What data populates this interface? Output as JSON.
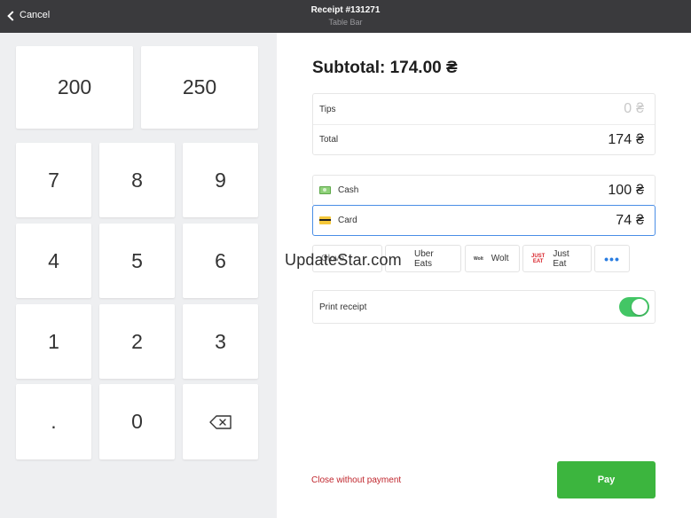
{
  "header": {
    "cancel_label": "Cancel",
    "title": "Receipt #131271",
    "subtitle": "Table Bar"
  },
  "keypad": {
    "quick": [
      "200",
      "250"
    ],
    "keys": [
      "7",
      "8",
      "9",
      "4",
      "5",
      "6",
      "1",
      "2",
      "3",
      ".",
      "0"
    ],
    "backspace_icon": "backspace-icon"
  },
  "summary": {
    "subtotal_label": "Subtotal: 174.00 ₴",
    "tips_label": "Tips",
    "tips_value": "0",
    "total_label": "Total",
    "total_value": "174",
    "currency": "₴"
  },
  "payments": {
    "cash_label": "Cash",
    "cash_value": "100",
    "card_label": "Card",
    "card_value": "74"
  },
  "methods": {
    "first": "Glovo",
    "uber": "Uber Eats",
    "wolt": "Wolt",
    "wolt_logo": "Wolt",
    "justeat": "Just Eat",
    "justeat_logo_1": "JUST",
    "justeat_logo_2": "EAT",
    "more": "•••"
  },
  "print": {
    "label": "Print receipt",
    "enabled": true
  },
  "watermark": "UpdateStar.com",
  "footer": {
    "close_label": "Close without payment",
    "pay_label": "Pay"
  },
  "colors": {
    "header_bg": "#3a3a3d",
    "pay_green": "#3cb53e",
    "toggle_green": "#43c665",
    "focus_blue": "#4a8ee6",
    "danger_red": "#c0262d",
    "link_blue": "#2a7de1"
  }
}
